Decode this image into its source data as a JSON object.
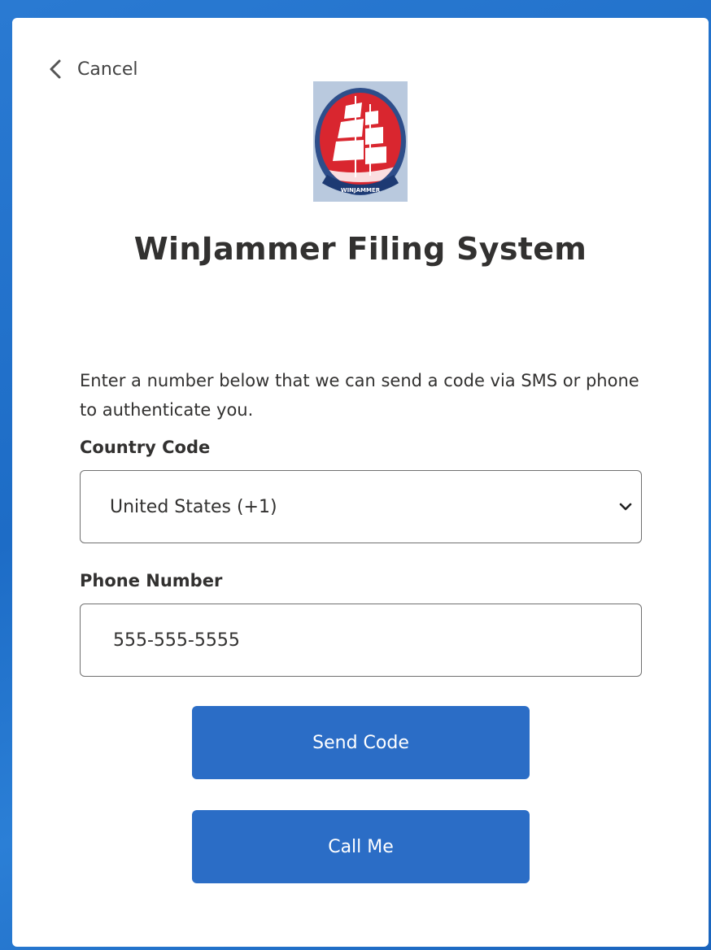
{
  "header": {
    "cancel_label": "Cancel"
  },
  "app": {
    "title": "WinJammer Filing System",
    "logo_text": "WINJAMMER"
  },
  "form": {
    "intro_text": "Enter a number below that we can send a code via SMS or phone to authenticate you.",
    "country_label": "Country Code",
    "country_value": "United States (+1)",
    "phone_label": "Phone Number",
    "phone_value": "555-555-5555"
  },
  "actions": {
    "send_code_label": "Send Code",
    "call_me_label": "Call Me"
  },
  "colors": {
    "accent": "#2b6dc6",
    "background": "#1f6fc9",
    "logo_red": "#d9262f"
  }
}
